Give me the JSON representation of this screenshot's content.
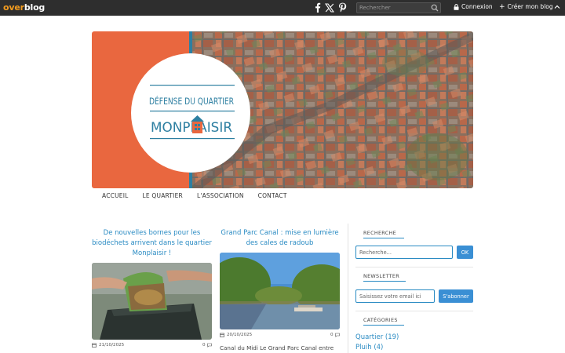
{
  "topbar": {
    "logo_over": "over",
    "logo_blog": "blog",
    "social_icons": [
      "facebook-icon",
      "x-icon",
      "pinterest-icon"
    ],
    "search_placeholder": "Rechercher",
    "login_label": "Connexion",
    "create_blog_label": "Créer mon blog"
  },
  "banner": {
    "title_line1": "DÉFENSE DU QUARTIER",
    "title_line2": "MONPLAISIR",
    "accent_color": "#e9673f"
  },
  "nav": {
    "items": [
      "ACCUEIL",
      "LE QUARTIER",
      "L'ASSOCIATION",
      "CONTACT"
    ]
  },
  "posts": [
    {
      "title_lines": [
        "De nouvelles bornes pour les",
        "biodéchets arrivent dans le quartier",
        "Monplaisir !"
      ],
      "date": "21/10/2025",
      "comments": "0"
    },
    {
      "title_lines": [
        "Grand Parc Canal : mise en lumière",
        "des cales de radoub"
      ],
      "date": "20/10/2025",
      "comments": "0",
      "excerpt": "Canal du Midi Le Grand Parc Canal entre"
    }
  ],
  "sidebar": {
    "search_title": "RECHERCHE",
    "search_placeholder": "Recherche...",
    "search_button": "OK",
    "newsletter_title": "NEWSLETTER",
    "newsletter_placeholder": "Saisissez votre email ici",
    "newsletter_button": "S'abonner",
    "categories_title": "CATÉGORIES",
    "categories": [
      "Quartier (19)",
      "Pluih (4)"
    ]
  },
  "colors": {
    "link_blue": "#2a8bc3",
    "button_blue": "#3a8fd4",
    "topbar_bg": "#2e2e2e",
    "logo_orange": "#f39c1f"
  }
}
